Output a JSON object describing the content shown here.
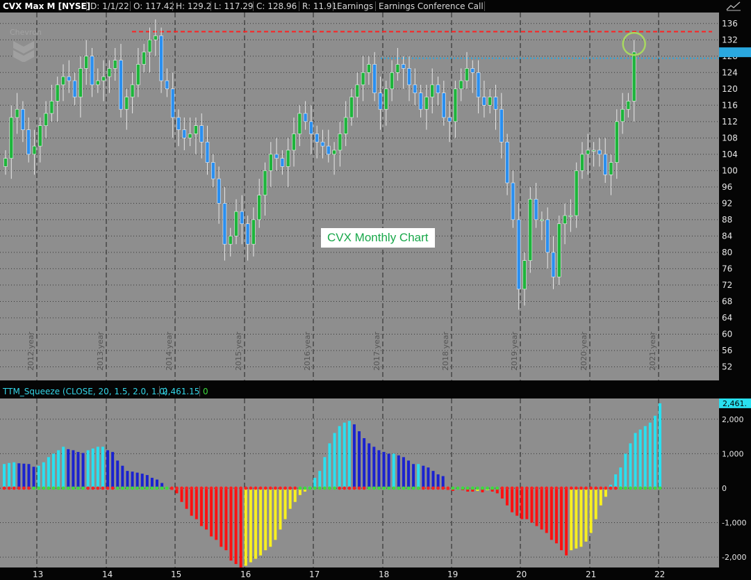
{
  "header": {
    "symbol": "CVX Max M [NYSE]",
    "date": "D: 1/1/22",
    "open": "O: 117.42",
    "high": "H: 129.2",
    "low": "L: 117.29",
    "close": "C: 128.96",
    "range": "R: 11.91",
    "earnings": "Earnings",
    "conference": "Earnings Conference Call"
  },
  "watermark": "Chevron",
  "chart_label": "CVX Monthly Chart",
  "icons": {
    "draw": "chart-draw-icon",
    "logo": "chevron-logo-icon"
  },
  "colors": {
    "up": "#1db53b",
    "down": "#2a8ff0",
    "bg": "#8e8e8e",
    "resistance": "#ff2020",
    "level": "#29a8e0",
    "circle": "#a8d860"
  },
  "squeeze_header": {
    "title": "TTM_Squeeze (CLOSE, 20, 1.5, 2.0, 1.0)",
    "value": "2,461.15",
    "flag": "0"
  },
  "chart_data": [
    {
      "type": "candlestick",
      "title": "CVX Max M [NYSE]",
      "ylim": [
        48,
        138
      ],
      "yticks": [
        52,
        56,
        60,
        64,
        68,
        72,
        76,
        80,
        84,
        88,
        92,
        96,
        100,
        104,
        108,
        112,
        116,
        120,
        124,
        128,
        132,
        136
      ],
      "year_labels": [
        "2012 year",
        "2013 year",
        "2014 year",
        "2015 year",
        "2016 year",
        "2017 year",
        "2018 year",
        "2019 year",
        "2020 year",
        "2021 year"
      ],
      "resistance_level": 134,
      "support_level": 127.5,
      "last_close": 128.96,
      "closes": [
        103,
        113,
        115,
        110,
        104,
        106,
        111,
        114,
        117,
        121,
        123,
        122,
        118,
        125,
        128,
        121,
        122,
        123,
        125,
        127,
        115,
        118,
        121,
        126,
        129,
        132,
        133,
        122,
        120,
        113,
        110,
        108,
        109,
        111,
        107,
        102,
        98,
        92,
        82,
        84,
        90,
        87,
        82,
        88,
        94,
        100,
        104,
        103,
        101,
        105,
        109,
        114,
        112,
        109,
        107,
        106,
        104,
        105,
        109,
        113,
        118,
        121,
        124,
        126,
        119,
        115,
        120,
        124,
        126,
        125,
        121,
        119,
        115,
        118,
        121,
        119,
        113,
        112,
        120,
        122,
        125,
        124,
        118,
        116,
        118,
        115,
        107,
        97,
        88,
        71,
        78,
        93,
        88,
        88,
        80,
        74,
        87,
        89,
        89,
        100,
        104,
        105,
        105,
        104,
        99,
        102,
        112,
        115,
        117,
        129
      ],
      "x_ticks": [
        "13",
        "14",
        "15",
        "16",
        "17",
        "18",
        "19",
        "20",
        "21",
        "22"
      ]
    },
    {
      "type": "bar",
      "title": "TTM_Squeeze (CLOSE, 20, 1.5, 2.0, 1.0)",
      "ylim": [
        -2300,
        2600
      ],
      "yticks": [
        -2000,
        -1000,
        0,
        1000,
        2000
      ],
      "ytick_labels": [
        "-2,000",
        "-1,000",
        "0",
        "1,000",
        "2,000"
      ],
      "last_value_label": "2,461.",
      "values": [
        700,
        730,
        750,
        720,
        710,
        700,
        620,
        650,
        750,
        900,
        1000,
        1100,
        1200,
        1130,
        1100,
        1050,
        1020,
        1100,
        1150,
        1200,
        1200,
        1100,
        1050,
        800,
        650,
        500,
        480,
        450,
        420,
        380,
        300,
        250,
        150,
        30,
        -50,
        -150,
        -400,
        -600,
        -800,
        -900,
        -1100,
        -1200,
        -1400,
        -1500,
        -1700,
        -1800,
        -2100,
        -2200,
        -2300,
        -2250,
        -2150,
        -2050,
        -1950,
        -1800,
        -1700,
        -1500,
        -1200,
        -900,
        -600,
        -400,
        -200,
        -100,
        50,
        300,
        500,
        900,
        1300,
        1600,
        1800,
        1900,
        1950,
        1850,
        1650,
        1450,
        1300,
        1200,
        1100,
        1050,
        1000,
        1000,
        950,
        900,
        800,
        700,
        700,
        650,
        600,
        500,
        400,
        350,
        -50,
        -80,
        -30,
        -60,
        -100,
        -100,
        -80,
        -120,
        -60,
        -100,
        -150,
        -300,
        -500,
        -700,
        -800,
        -900,
        -900,
        -1000,
        -1100,
        -1200,
        -1300,
        -1500,
        -1600,
        -1800,
        -1950,
        -1800,
        -1750,
        -1700,
        -1550,
        -1300,
        -900,
        -500,
        -250,
        100,
        400,
        600,
        1000,
        1300,
        1600,
        1700,
        1800,
        1900,
        2100,
        2461
      ]
    }
  ]
}
